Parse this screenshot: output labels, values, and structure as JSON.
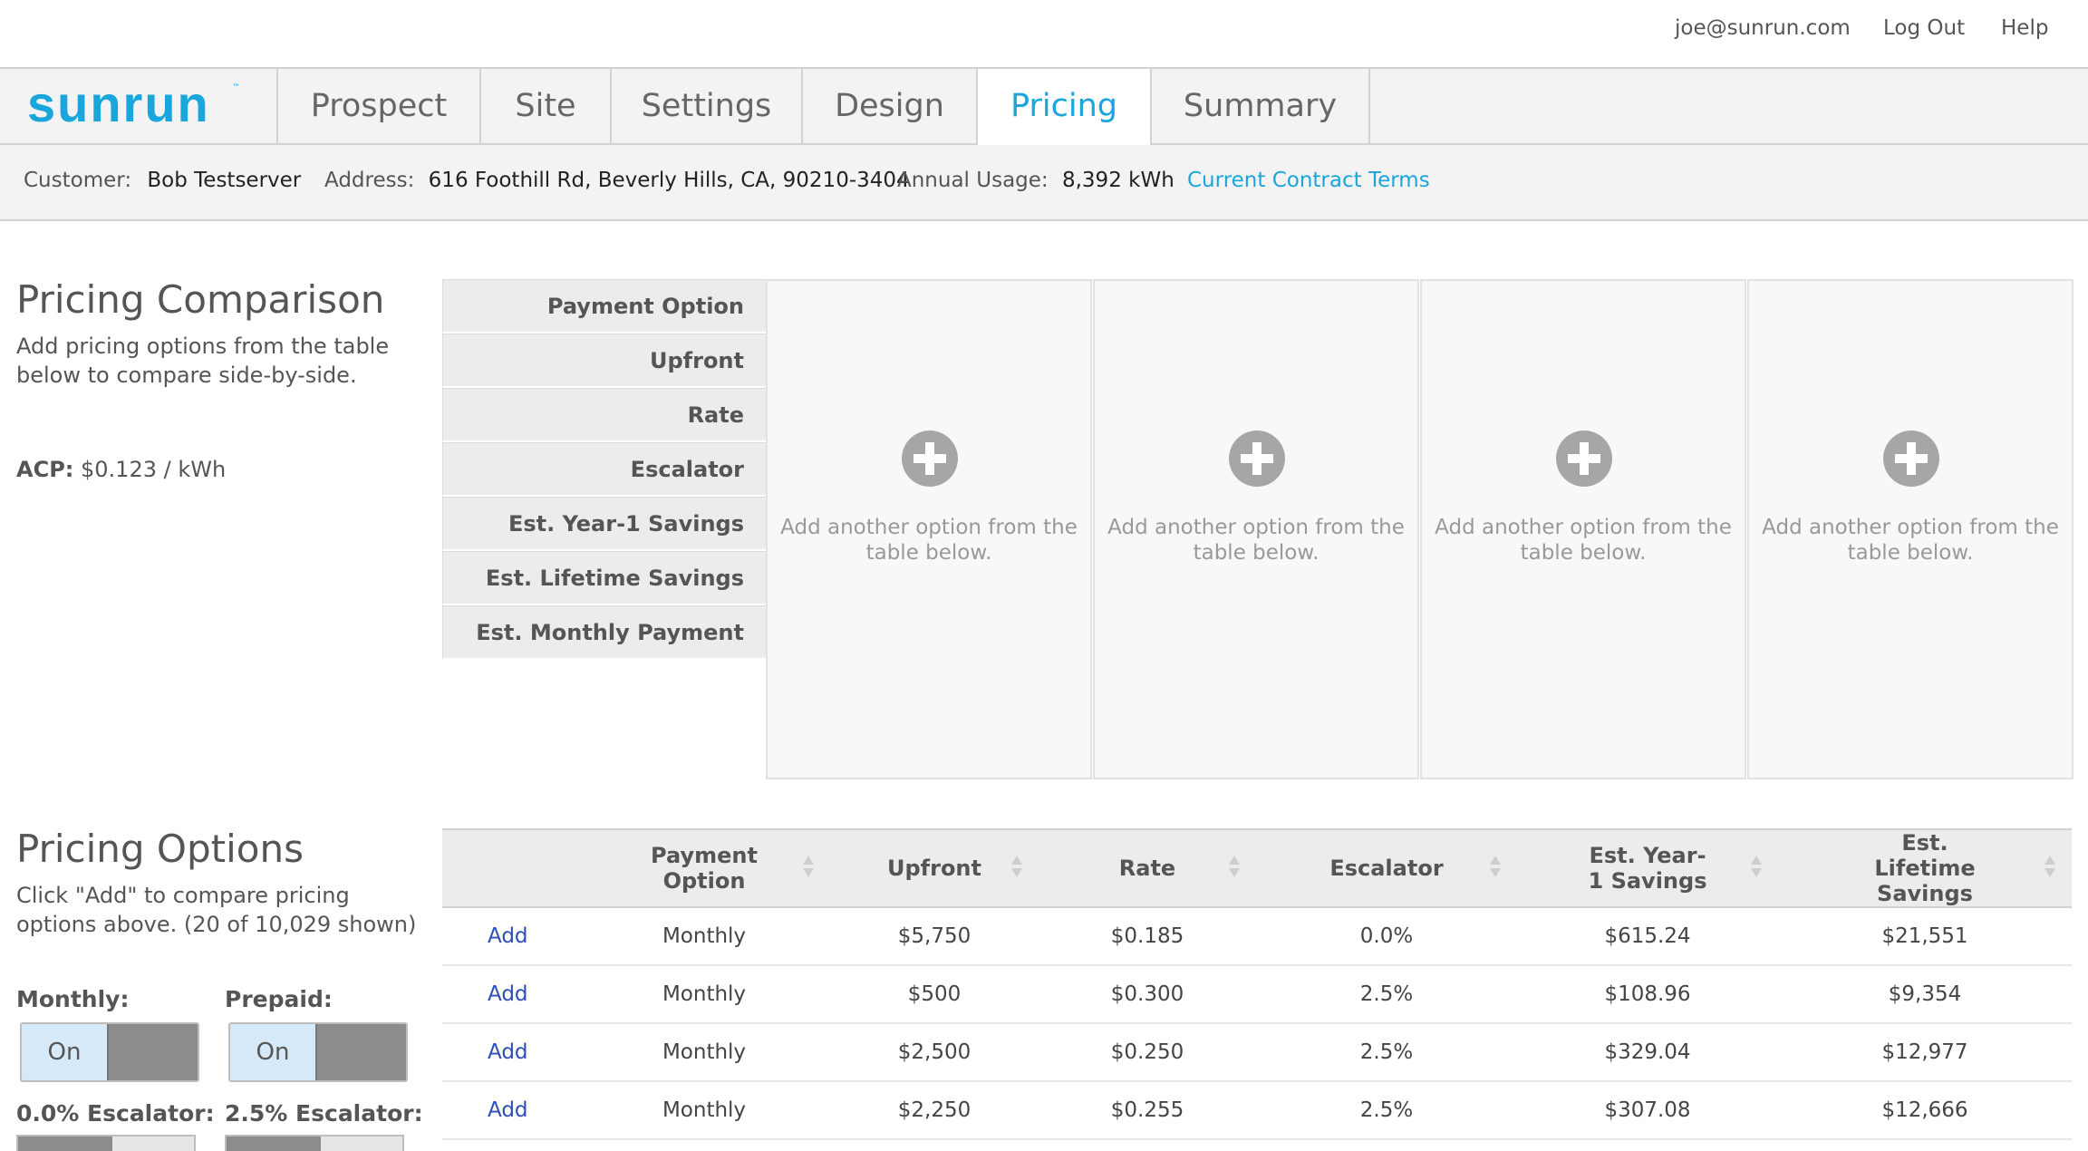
{
  "topbar": {
    "user_email": "joe@sunrun.com",
    "logout": "Log Out",
    "help": "Help"
  },
  "nav": {
    "logo": "sunrun",
    "logo_tm": "™",
    "tabs": [
      {
        "label": "Prospect"
      },
      {
        "label": "Site"
      },
      {
        "label": "Settings"
      },
      {
        "label": "Design"
      },
      {
        "label": "Pricing",
        "active": true
      },
      {
        "label": "Summary"
      }
    ]
  },
  "info": {
    "customer_label": "Customer:",
    "customer_value": "Bob Testserver",
    "address_label": "Address:",
    "address_value": "616 Foothill Rd, Beverly Hills, CA, 90210-3404",
    "usage_label": "Annual Usage:",
    "usage_value": "8,392 kWh",
    "contract_link": "Current Contract Terms"
  },
  "comparison": {
    "title": "Pricing Comparison",
    "description": "Add pricing options from the table below to compare side-by-side.",
    "acp_label": "ACP:",
    "acp_value": "$0.123 / kWh",
    "row_labels": [
      "Payment Option",
      "Upfront",
      "Rate",
      "Escalator",
      "Est. Year-1 Savings",
      "Est. Lifetime Savings",
      "Est. Monthly Payment"
    ],
    "slots": [
      {
        "text": "Add another option from the table below."
      },
      {
        "text": "Add another option from the table below."
      },
      {
        "text": "Add another option from the table below."
      },
      {
        "text": "Add another option from the table below."
      }
    ]
  },
  "options": {
    "title": "Pricing Options",
    "description": "Click \"Add\" to compare pricing options above. (20 of 10,029 shown)",
    "columns": [
      "",
      "Payment Option",
      "Upfront",
      "Rate",
      "Escalator",
      "Est. Year-1 Savings",
      "Est. Lifetime Savings"
    ],
    "rows": [
      {
        "action": "Add",
        "payment": "Monthly",
        "upfront": "$5,750",
        "rate": "$0.185",
        "escalator": "0.0%",
        "year1": "$615.24",
        "lifetime": "$21,551"
      },
      {
        "action": "Add",
        "payment": "Monthly",
        "upfront": "$500",
        "rate": "$0.300",
        "escalator": "2.5%",
        "year1": "$108.96",
        "lifetime": "$9,354"
      },
      {
        "action": "Add",
        "payment": "Monthly",
        "upfront": "$2,500",
        "rate": "$0.250",
        "escalator": "2.5%",
        "year1": "$329.04",
        "lifetime": "$12,977"
      },
      {
        "action": "Add",
        "payment": "Monthly",
        "upfront": "$2,250",
        "rate": "$0.255",
        "escalator": "2.5%",
        "year1": "$307.08",
        "lifetime": "$12,666"
      }
    ]
  },
  "filters": {
    "monthly_label": "Monthly:",
    "monthly_state": "On",
    "prepaid_label": "Prepaid:",
    "prepaid_state": "On",
    "esc0_label": "0.0% Escalator:",
    "esc25_label": "2.5% Escalator:"
  }
}
